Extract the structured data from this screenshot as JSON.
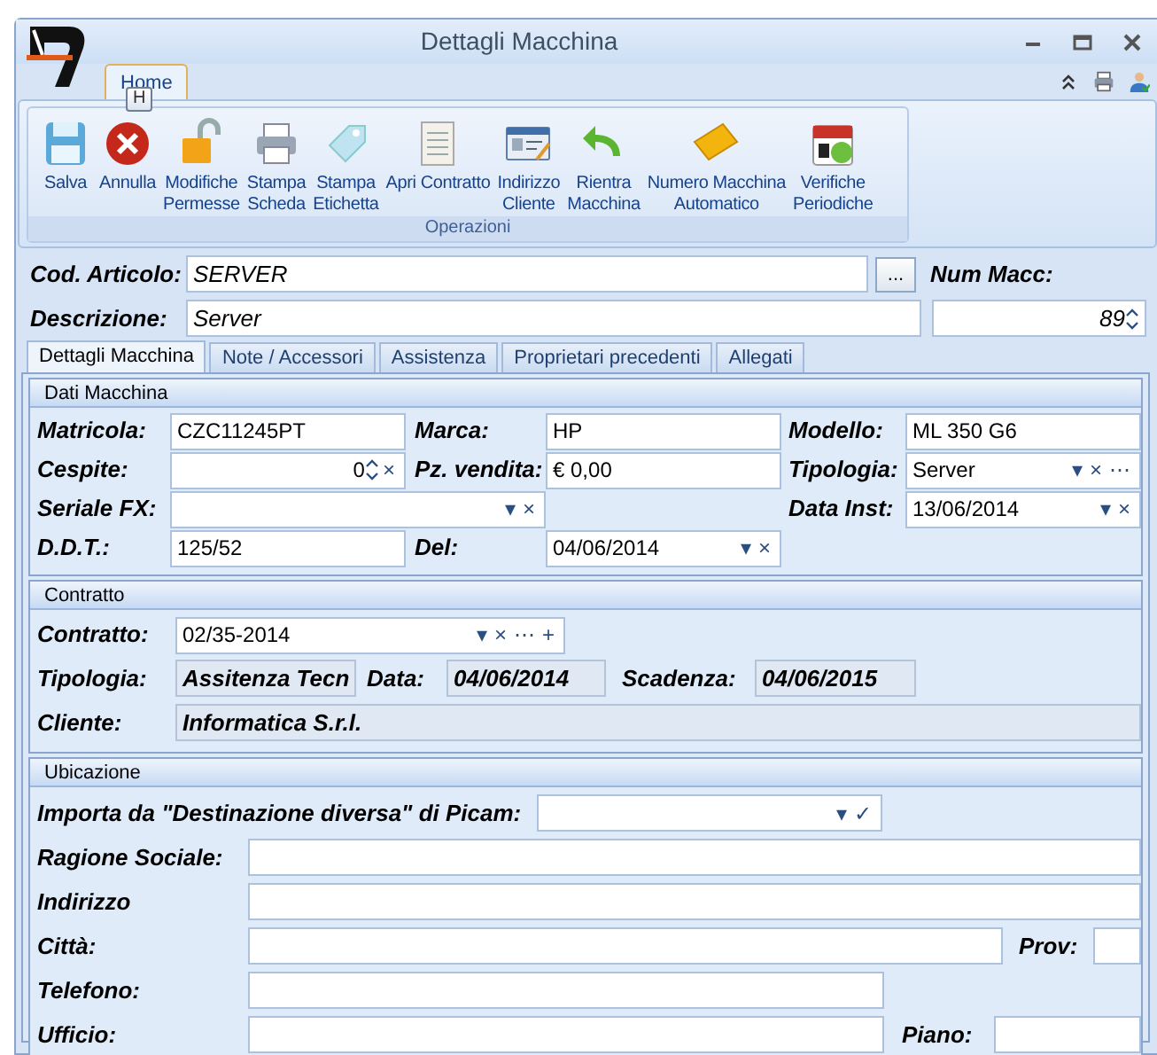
{
  "window": {
    "title": "Dettagli Macchina"
  },
  "ribbon": {
    "tabs": [
      {
        "label": "Home",
        "selected": true,
        "key_tip": "H"
      }
    ],
    "groups": [
      {
        "label": "Operazioni",
        "buttons": [
          {
            "lines": [
              "Salva"
            ]
          },
          {
            "lines": [
              "Annulla"
            ]
          },
          {
            "lines": [
              "Modifiche",
              "Permesse"
            ]
          },
          {
            "lines": [
              "Stampa",
              "Scheda"
            ]
          },
          {
            "lines": [
              "Stampa",
              "Etichetta"
            ]
          },
          {
            "lines": [
              "Apri Contratto"
            ]
          },
          {
            "lines": [
              "Indirizzo",
              "Cliente"
            ]
          },
          {
            "lines": [
              "Rientra",
              "Macchina"
            ]
          },
          {
            "lines": [
              "Numero Macchina",
              "Automatico"
            ]
          },
          {
            "lines": [
              "Verifiche",
              "Periodiche"
            ]
          }
        ]
      }
    ]
  },
  "header": {
    "cod_articolo": {
      "label": "Cod. Articolo:",
      "value": "SERVER",
      "button": "..."
    },
    "num_macc": {
      "label": "Num Macc:",
      "value": "89"
    },
    "descrizione": {
      "label": "Descrizione:",
      "value": "Server"
    }
  },
  "tabs": [
    {
      "label": "Dettagli Macchina",
      "selected": true
    },
    {
      "label": "Note / Accessori",
      "selected": false
    },
    {
      "label": "Assistenza",
      "selected": false
    },
    {
      "label": "Proprietari precedenti",
      "selected": false
    },
    {
      "label": "Allegati",
      "selected": false
    }
  ],
  "sections": [
    {
      "title": "Dati Macchina",
      "rows": [
        [
          {
            "label": "Matricola:",
            "value": "CZC11245PT",
            "kind": "text"
          },
          {
            "label": "Marca:",
            "value": "HP",
            "kind": "text"
          },
          {
            "label": "Modello:",
            "value": "ML 350 G6",
            "kind": "text"
          }
        ],
        [
          {
            "label": "Cespite:",
            "value": "0",
            "kind": "number",
            "buttons": [
              {
                "kind": "spin"
              },
              {
                "kind": "clear",
                "glyph": "×"
              }
            ]
          },
          {
            "label": "Pz. vendita:",
            "value": "€ 0,00",
            "kind": "text"
          },
          {
            "label": "Tipologia:",
            "value": "Server",
            "kind": "text",
            "buttons": [
              {
                "kind": "dropdown",
                "glyph": "▾"
              },
              {
                "kind": "clear",
                "glyph": "×"
              },
              {
                "kind": "more",
                "glyph": "⋯"
              }
            ]
          }
        ],
        [
          {
            "label": "Seriale FX:",
            "kind": "text",
            "buttons": [
              {
                "kind": "dropdown",
                "glyph": "▾"
              },
              {
                "kind": "clear",
                "glyph": "×"
              }
            ]
          },
          {
            "kind": "empty"
          },
          {
            "label": "Data Inst:",
            "value": "13/06/2014",
            "kind": "text",
            "buttons": [
              {
                "kind": "dropdown",
                "glyph": "▾"
              },
              {
                "kind": "clear",
                "glyph": "×"
              }
            ]
          }
        ],
        [
          {
            "label": "D.D.T.:",
            "value": "125/52",
            "kind": "text"
          },
          {
            "label": "Del:",
            "value": "04/06/2014",
            "kind": "text",
            "buttons": [
              {
                "kind": "dropdown",
                "glyph": "▾"
              },
              {
                "kind": "clear",
                "glyph": "×"
              }
            ]
          }
        ]
      ]
    },
    {
      "title": "Contratto",
      "rows": [
        [
          {
            "label": "Contratto:",
            "value": "02/35-2014",
            "kind": "text",
            "buttons": [
              {
                "kind": "dropdown",
                "glyph": "▾"
              },
              {
                "kind": "clear",
                "glyph": "×"
              },
              {
                "kind": "more",
                "glyph": "⋯"
              },
              {
                "kind": "add",
                "glyph": "+"
              }
            ]
          }
        ],
        [
          {
            "label": "Tipologia:",
            "value": "Assitenza Tecn",
            "kind": "readonly"
          },
          {
            "label": "Data:",
            "value": "04/06/2014",
            "kind": "readonly"
          },
          {
            "label": "Scadenza:",
            "value": "04/06/2015",
            "kind": "readonly"
          }
        ],
        [
          {
            "label": "Cliente:",
            "value": "Informatica S.r.l.",
            "kind": "readonly"
          }
        ]
      ]
    },
    {
      "title": "Ubicazione",
      "rows": [
        [
          {
            "label": "Importa da \"Destinazione diversa\" di Picam:",
            "kind": "text",
            "buttons": [
              {
                "kind": "dropdown",
                "glyph": "▾"
              },
              {
                "kind": "confirm",
                "glyph": "✓"
              }
            ]
          }
        ],
        [
          {
            "label": "Ragione Sociale:",
            "kind": "text"
          }
        ],
        [
          {
            "label": "Indirizzo",
            "kind": "text"
          }
        ],
        [
          {
            "label": "Città:",
            "kind": "text"
          },
          {
            "label": "Prov:",
            "kind": "text"
          }
        ],
        [
          {
            "label": "Telefono:",
            "kind": "text"
          }
        ],
        [
          {
            "label": "Ufficio:",
            "kind": "text"
          },
          {
            "label": "Piano:",
            "kind": "text"
          }
        ]
      ]
    }
  ]
}
